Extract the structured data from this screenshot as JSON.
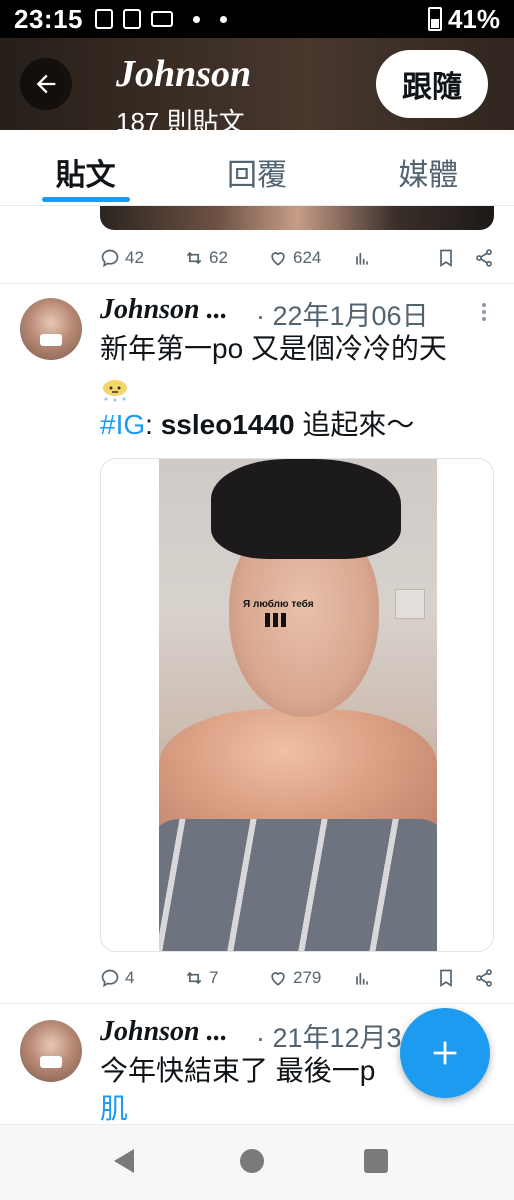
{
  "status_bar": {
    "time": "23:15",
    "battery": "41%"
  },
  "header": {
    "name": "Johnson",
    "post_count": "187 則貼文",
    "follow_label": "跟隨"
  },
  "tabs": [
    {
      "label": "貼文",
      "active": true
    },
    {
      "label": "回覆",
      "active": false
    },
    {
      "label": "媒體",
      "active": false
    }
  ],
  "prev_tweet": {
    "replies": "42",
    "retweets": "62",
    "likes": "624"
  },
  "tweet1": {
    "name": "Johnson ...",
    "date": "· 22年1月06日",
    "text": "新年第一po 又是個冷冷的天",
    "hashtag": "#IG",
    "colon": ": ",
    "account": "ssleo1440",
    "suffix": " 追起來～",
    "photo_sticker": "Я люблю тебя",
    "replies": "4",
    "retweets": "7",
    "likes": "279"
  },
  "tweet2": {
    "name": "Johnson ...",
    "date": "· 21年12月3",
    "text": "今年快結束了 最後一p",
    "hashtag": "肌"
  },
  "colors": {
    "accent": "#1d9bf0",
    "text": "#0f1419",
    "muted": "#536471"
  },
  "icons": [
    "back-arrow-icon",
    "reply-icon",
    "retweet-icon",
    "like-icon",
    "views-icon",
    "bookmark-icon",
    "share-icon",
    "more-icon",
    "compose-plus-icon"
  ]
}
